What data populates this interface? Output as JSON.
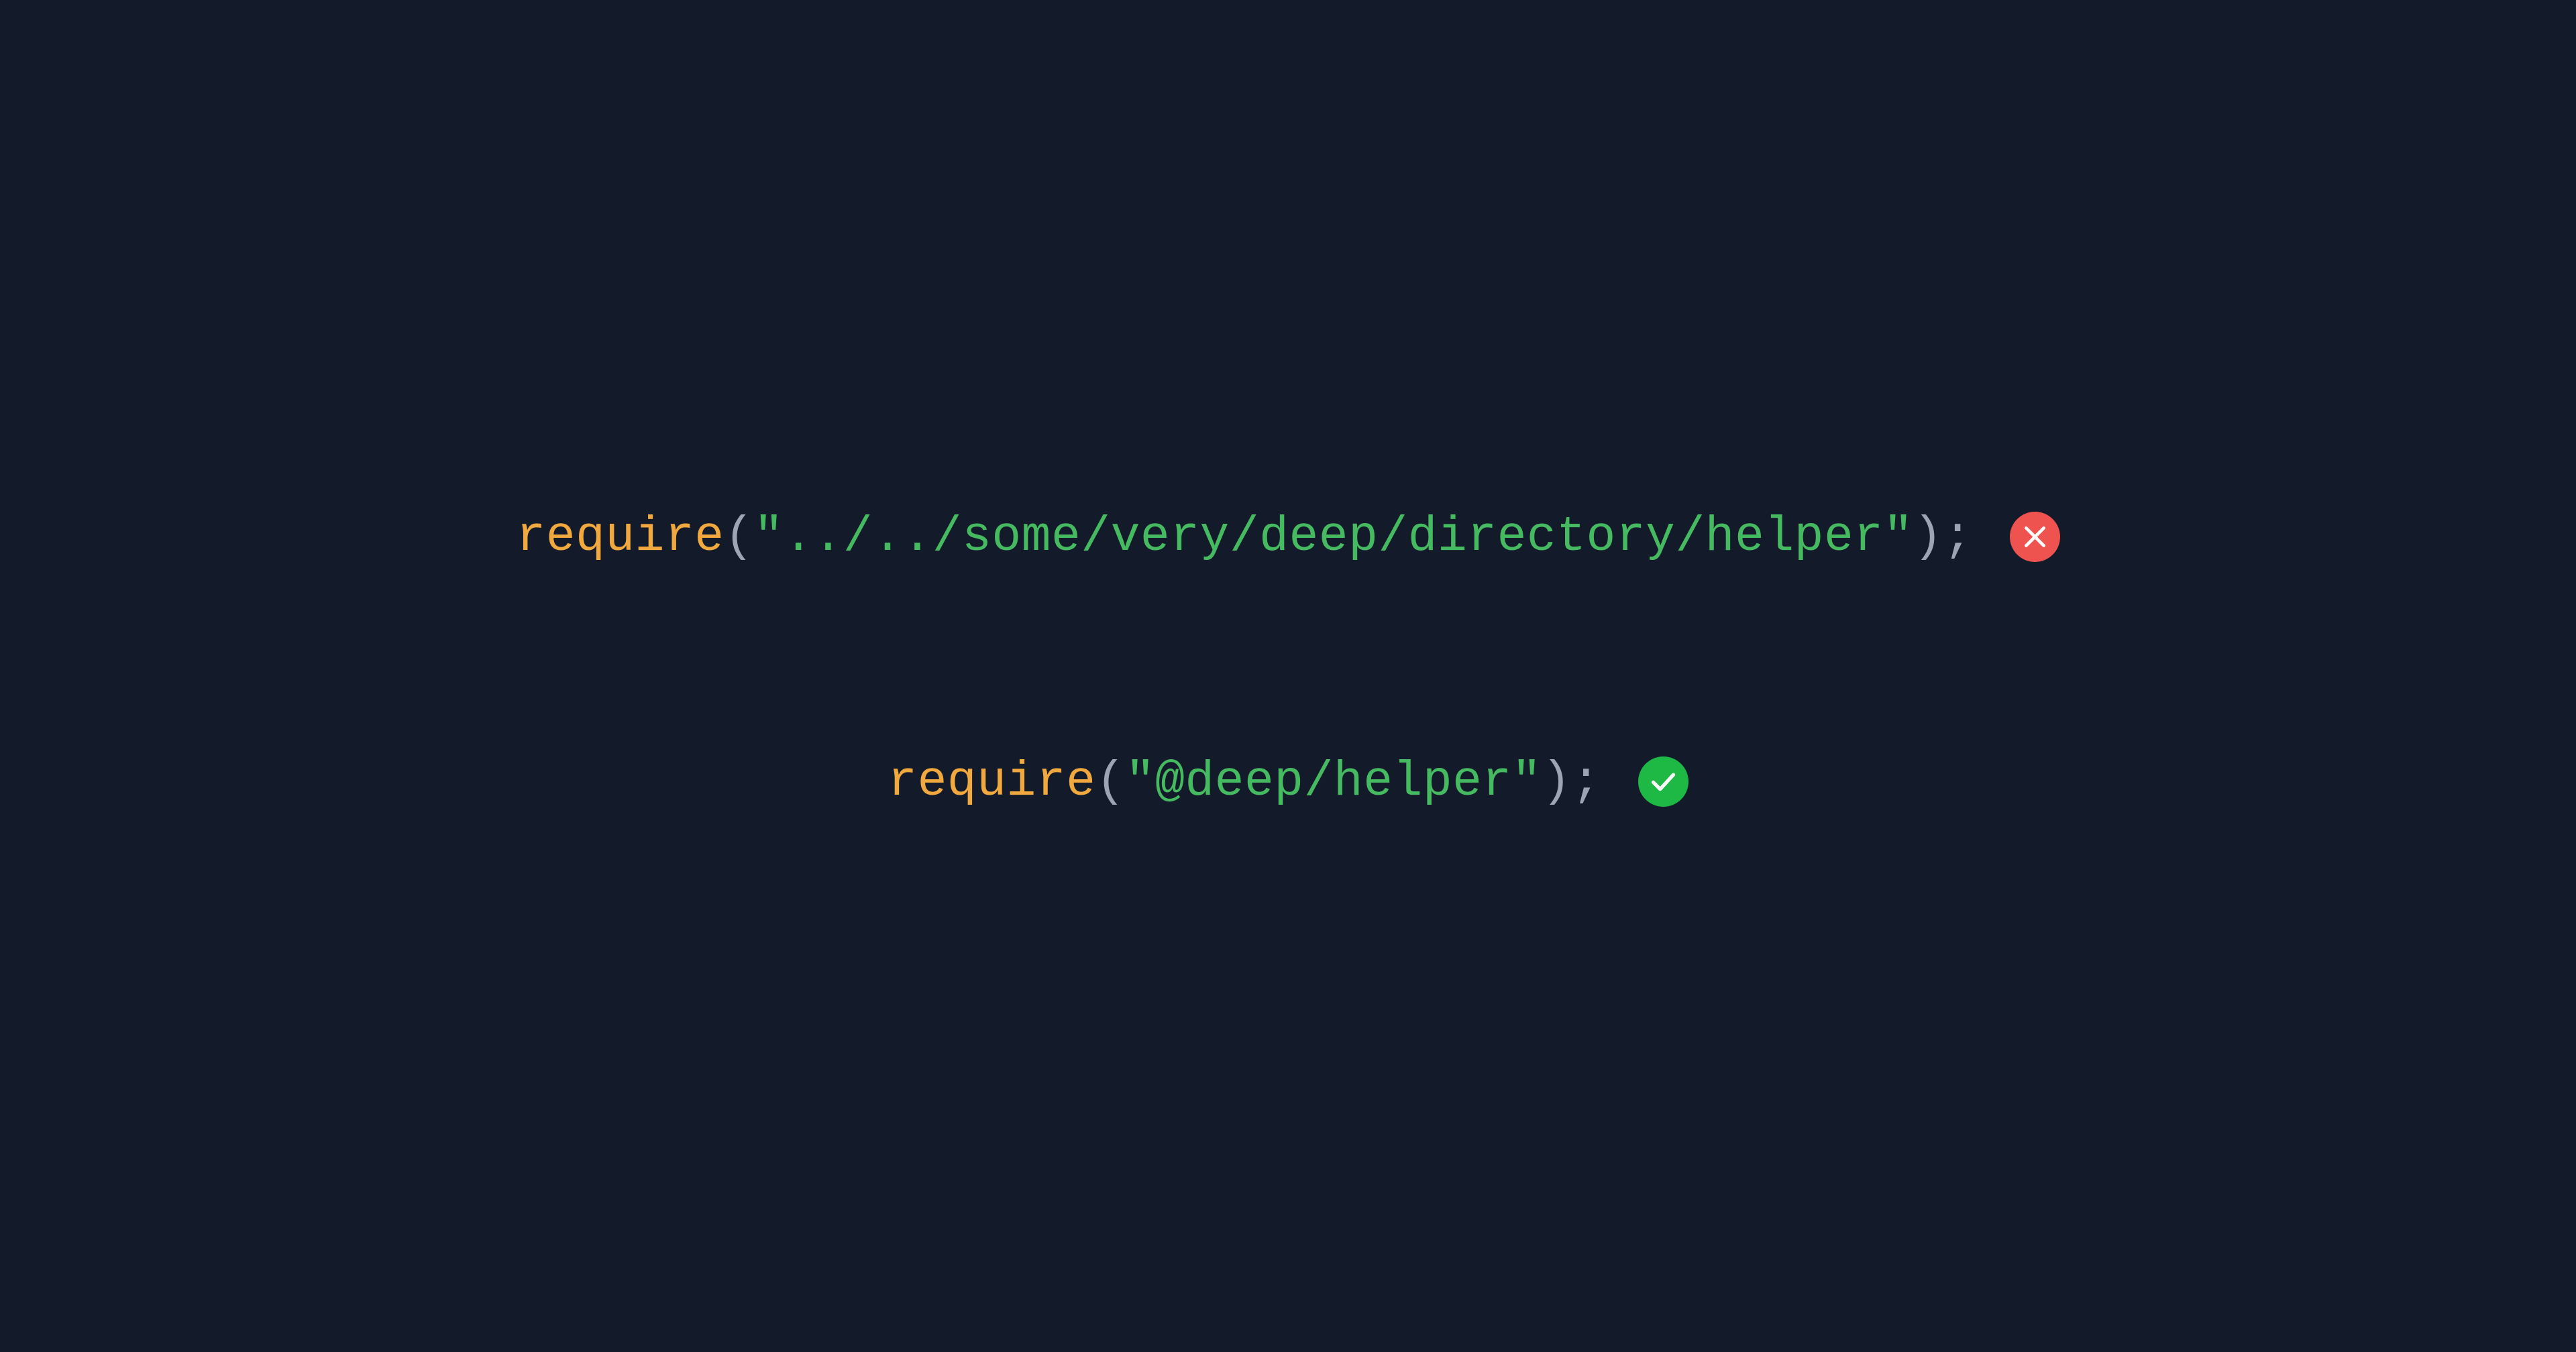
{
  "lines": [
    {
      "keyword": "require",
      "openParen": "(",
      "string": "\"../../some/very/deep/directory/helper\"",
      "closeParen": ")",
      "semicolon": ";",
      "status": "bad"
    },
    {
      "keyword": "require",
      "openParen": "(",
      "string": "\"@deep/helper\"",
      "closeParen": ")",
      "semicolon": ";",
      "status": "good"
    }
  ]
}
